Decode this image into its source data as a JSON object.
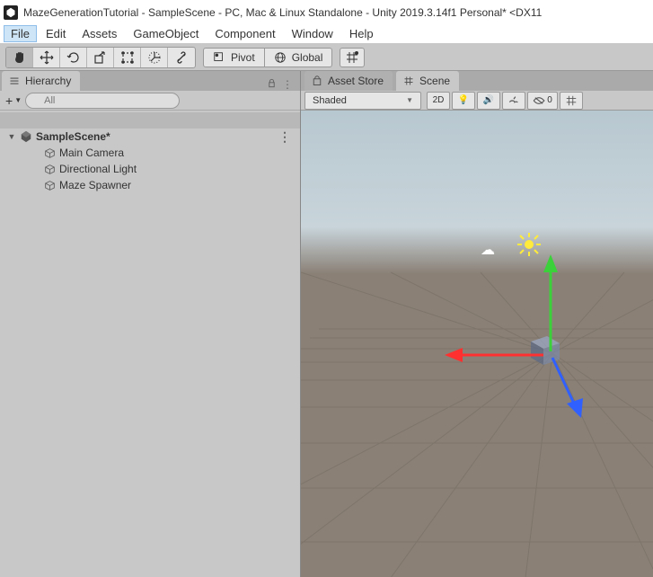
{
  "window": {
    "title": "MazeGenerationTutorial - SampleScene - PC, Mac & Linux Standalone - Unity 2019.3.14f1 Personal* <DX11"
  },
  "menubar": {
    "items": [
      "File",
      "Edit",
      "Assets",
      "GameObject",
      "Component",
      "Window",
      "Help"
    ],
    "active_index": 0
  },
  "toolbar": {
    "pivot_label": "Pivot",
    "global_label": "Global"
  },
  "hierarchy": {
    "tab_label": "Hierarchy",
    "search_placeholder": "All",
    "root": "SampleScene*",
    "items": [
      "Main Camera",
      "Directional Light",
      "Maze Spawner"
    ]
  },
  "scene": {
    "tabs": {
      "asset_store": "Asset Store",
      "scene": "Scene"
    },
    "shaded_label": "Shaded",
    "view2d_label": "2D",
    "hidden_count": "0"
  }
}
